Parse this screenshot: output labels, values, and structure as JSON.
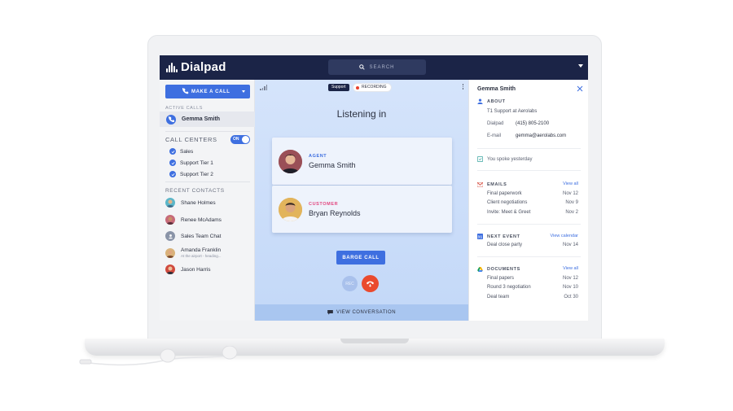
{
  "app": {
    "name": "Dialpad"
  },
  "colors": {
    "navy": "#1b2447",
    "accent": "#3e6fe0",
    "agent": "#3e6fe0",
    "customer": "#e2467f",
    "hangup": "#ea4a2e"
  },
  "topbar": {
    "search_placeholder": "SEARCH"
  },
  "sidebar": {
    "make_call_label": "MAKE A CALL",
    "active_calls_title": "ACTIVE CALLS",
    "active_call_name": "Gemma Smith",
    "call_centers_title": "CALL CENTERS",
    "call_centers_toggle": "ON",
    "call_centers": [
      "Sales",
      "Support Tier 1",
      "Support Tier 2"
    ],
    "recent_contacts_title": "RECENT CONTACTS",
    "recent_contacts": [
      {
        "name": "Shane Holmes",
        "status": ""
      },
      {
        "name": "Renee McAdams",
        "status": ""
      },
      {
        "name": "Sales Team Chat",
        "status": ""
      },
      {
        "name": "Amanda Franklin",
        "status": "At the airport - heading..."
      },
      {
        "name": "Jason Harris",
        "status": ""
      }
    ]
  },
  "center": {
    "support_badge": "Support",
    "recording_label": "RECORDING",
    "title": "Listening in",
    "agent": {
      "role": "AGENT",
      "name": "Gemma Smith"
    },
    "customer": {
      "role": "CUSTOMER",
      "name": "Bryan Reynolds"
    },
    "barge_label": "BARGE CALL",
    "rec_label": "REC",
    "view_conversation_label": "VIEW CONVERSATION"
  },
  "details": {
    "name": "Gemma Smith",
    "about_title": "ABOUT",
    "about_line": "T1 Support at Aerolabs",
    "dialpad_key": "Dialpad",
    "dialpad_value": "(415) 805-2100",
    "email_key": "E-mail",
    "email_value": "gemma@aerolabs.com",
    "spoke_note": "You spoke yesterday",
    "emails": {
      "title": "EMAILS",
      "link": "View all",
      "items": [
        {
          "text": "Final paperwork",
          "date": "Nov 12"
        },
        {
          "text": "Client negotiations",
          "date": "Nov 9"
        },
        {
          "text": "Invite: Meet & Greet",
          "date": "Nov 2"
        }
      ]
    },
    "next_event": {
      "title": "NEXT EVENT",
      "link": "View calendar",
      "items": [
        {
          "text": "Deal close party",
          "date": "Nov 14"
        }
      ]
    },
    "documents": {
      "title": "DOCUMENTS",
      "link": "View all",
      "items": [
        {
          "text": "Final papers",
          "date": "Nov 12"
        },
        {
          "text": "Round 3 negotiation",
          "date": "Nov 10"
        },
        {
          "text": "Deal team",
          "date": "Oct 30"
        }
      ]
    }
  }
}
